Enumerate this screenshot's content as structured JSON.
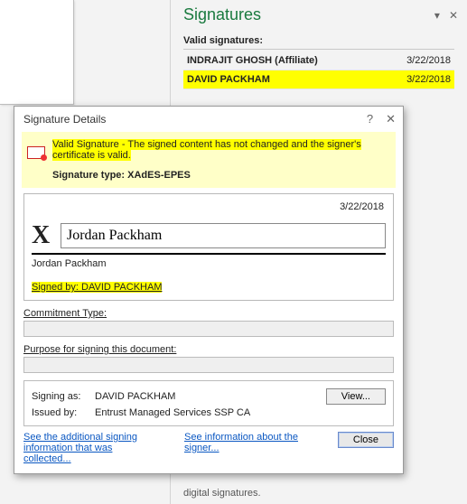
{
  "panel": {
    "title": "Signatures",
    "subheader": "Valid signatures:",
    "items": [
      {
        "name": "INDRAJIT GHOSH (Affiliate)",
        "date": "3/22/2018"
      },
      {
        "name": "DAVID PACKHAM",
        "date": "3/22/2018"
      }
    ],
    "footer": "digital signatures."
  },
  "dialog": {
    "title": "Signature Details",
    "valid_msg": "Valid Signature - The signed content has not changed and the signer's certificate is valid.",
    "sig_type_label": "Signature type:",
    "sig_type_value": "XAdES-EPES",
    "date": "3/22/2018",
    "x_mark": "X",
    "signature_value": "Jordan Packham",
    "printed_name": "Jordan Packham",
    "signed_by_full": "Signed by: DAVID PACKHAM",
    "commitment_label": "Commitment Type:",
    "purpose_label": "Purpose for signing this document:",
    "signing_as_label": "Signing as:",
    "signing_as_value": "DAVID PACKHAM",
    "issued_by_label": "Issued by:",
    "issued_by_value": "Entrust Managed Services SSP CA",
    "view_btn": "View...",
    "link1": "See the additional signing information that was collected...",
    "link2": "See information about the signer...",
    "close_btn": "Close"
  }
}
